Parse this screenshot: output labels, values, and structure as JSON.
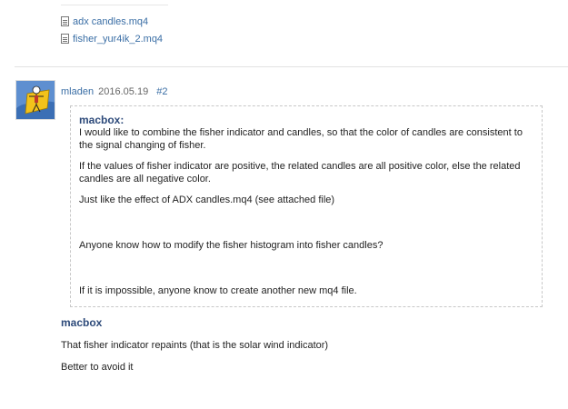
{
  "attachments": [
    {
      "name": "adx candles.mq4",
      "icon": "file-icon"
    },
    {
      "name": "fisher_yur4ik_2.mq4",
      "icon": "file-icon"
    }
  ],
  "post": {
    "author": "mladen",
    "date": "2016.05.19",
    "number": "#2",
    "quote": {
      "author": "macbox:",
      "paragraphs": [
        "I would like to combine the fisher indicator and candles, so that the color of candles are consistent to the signal changing of fisher.",
        "If the values of fisher indicator are positive, the related candles are all positive color, else the related candles are all negative color.",
        "Just like the effect of ADX candles.mq4 (see attached file)",
        "Anyone know how to modify the fisher histogram into fisher candles?",
        "If it is impossible, anyone know to create another new mq4 file."
      ]
    },
    "reply": {
      "quoted_author": "macbox",
      "lines": [
        "That fisher indicator repaints (that is the solar wind indicator)",
        "Better to avoid it"
      ]
    }
  },
  "colors": {
    "link": "#3a6ea5",
    "quote_author": "#2d4a7a",
    "avatar_bg": "#5e8fd0"
  }
}
